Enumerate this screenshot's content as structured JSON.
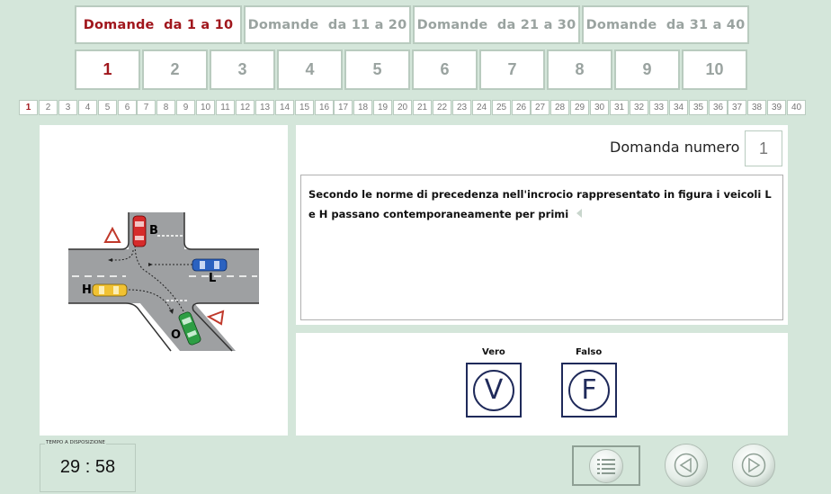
{
  "range_tabs": [
    {
      "label": "Domande  da 1 a 10",
      "active": true
    },
    {
      "label": "Domande  da 11 a 20",
      "active": false
    },
    {
      "label": "Domande  da 21 a 30",
      "active": false
    },
    {
      "label": "Domande  da 31 a 40",
      "active": false
    }
  ],
  "question_tabs": [
    "1",
    "2",
    "3",
    "4",
    "5",
    "6",
    "7",
    "8",
    "9",
    "10"
  ],
  "active_question_tab": "1",
  "number_strip": [
    "1",
    "2",
    "3",
    "4",
    "5",
    "6",
    "7",
    "8",
    "9",
    "10",
    "11",
    "12",
    "13",
    "14",
    "15",
    "16",
    "17",
    "18",
    "19",
    "20",
    "21",
    "22",
    "23",
    "24",
    "25",
    "26",
    "27",
    "28",
    "29",
    "30",
    "31",
    "32",
    "33",
    "34",
    "35",
    "36",
    "37",
    "38",
    "39",
    "40"
  ],
  "question": {
    "title_label": "Domanda numero",
    "number": "1",
    "text": "Secondo le norme di precedenza nell'incrocio rappresentato in figura i veicoli L e H passano contemporaneamente per primi"
  },
  "figure": {
    "vehicle_labels": [
      "B",
      "L",
      "H",
      "O"
    ]
  },
  "answers": {
    "true_label": "Vero",
    "false_label": "Falso",
    "true_symbol": "V",
    "false_symbol": "F"
  },
  "timer": {
    "label": "TEMPO A DISPOSIZIONE",
    "value": "29 : 58"
  },
  "icons": {
    "list": "list-icon",
    "prev": "arrow-left-icon",
    "next": "arrow-right-icon",
    "audio": "speaker-icon"
  },
  "colors": {
    "background": "#d4e6da",
    "active_text": "#a0161c",
    "inactive_text": "#9aa3a0",
    "answer_border": "#1f2a5a"
  }
}
